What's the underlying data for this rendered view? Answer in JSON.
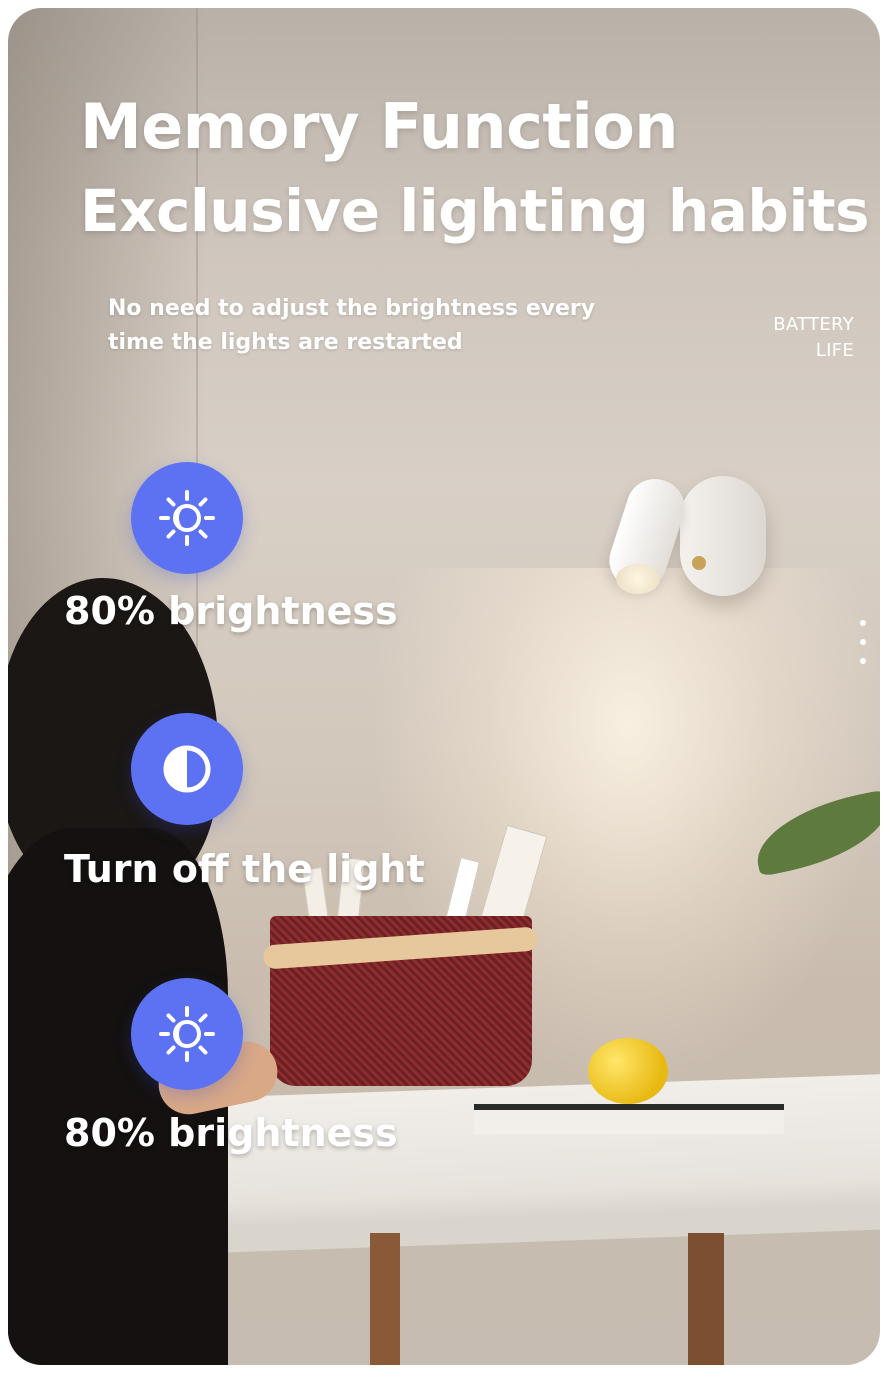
{
  "headline": {
    "line1": "Memory Function",
    "line2": "Exclusive lighting habits"
  },
  "subtitle": "No need to adjust the brightness every time the lights are restarted",
  "side_label": {
    "line1": "BATTERY",
    "line2": "LIFE"
  },
  "steps": [
    {
      "icon": "brightness-icon",
      "label": "80% brightness"
    },
    {
      "icon": "contrast-half-circle-icon",
      "label": "Turn off the light"
    },
    {
      "icon": "brightness-icon",
      "label": "80% brightness"
    }
  ],
  "colors": {
    "badge": "#5d72f2",
    "text": "#ffffff"
  }
}
